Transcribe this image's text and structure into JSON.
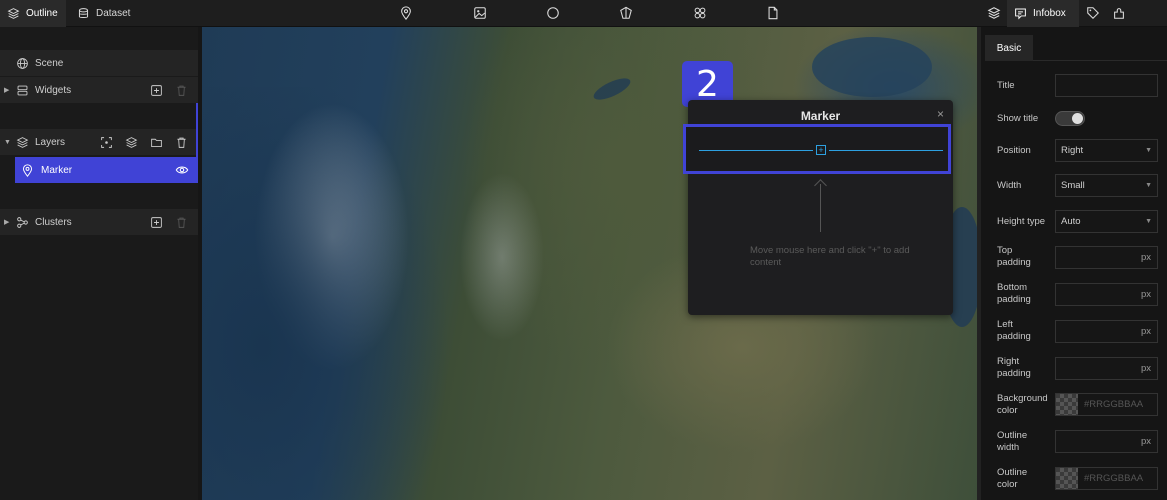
{
  "topbar": {
    "left_tabs": [
      {
        "label": "Outline",
        "icon": "layers-icon"
      },
      {
        "label": "Dataset",
        "icon": "database-icon"
      }
    ],
    "tools": [
      "map-pin-icon",
      "image-icon",
      "circle-icon",
      "polygon-icon",
      "models-icon",
      "file-icon"
    ],
    "right_tabs": [
      {
        "label": "",
        "icon": "layers-icon"
      },
      {
        "label": "Infobox",
        "icon": "infobox-icon"
      },
      {
        "label": "",
        "icon": "tag-icon"
      },
      {
        "label": "",
        "icon": "plugin-icon"
      }
    ]
  },
  "outline": {
    "scene": "Scene",
    "widgets": "Widgets",
    "layers": "Layers",
    "marker": "Marker",
    "clusters": "Clusters"
  },
  "map": {
    "badge_number": "2"
  },
  "infobox": {
    "title": "Marker",
    "close": "×",
    "plus": "+",
    "hint": "Move mouse here and click \"+\" to add content"
  },
  "properties": {
    "tab": "Basic",
    "title_label": "Title",
    "title_value": "",
    "show_title_label": "Show title",
    "show_title": true,
    "position_label": "Position",
    "position_value": "Right",
    "width_label": "Width",
    "width_value": "Small",
    "height_type_label": "Height type",
    "height_type_value": "Auto",
    "top_padding_label": "Top padding",
    "bottom_padding_label": "Bottom padding",
    "left_padding_label": "Left padding",
    "right_padding_label": "Right padding",
    "background_color_label": "Background color",
    "outline_width_label": "Outline width",
    "outline_color_label": "Outline color",
    "unit": "px",
    "color_placeholder": "#RRGGBBAA"
  },
  "colors": {
    "accent": "#4043d6",
    "block_line": "#2da0e0"
  }
}
